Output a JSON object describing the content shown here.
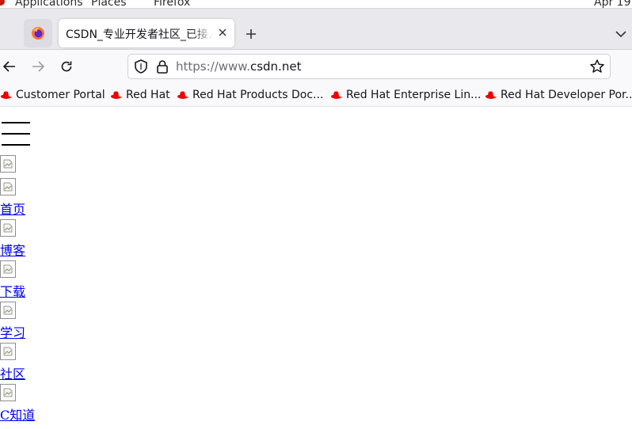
{
  "system_bar": {
    "applications": "Applications",
    "places": "Places",
    "app_name": "Firefox",
    "clock": "Apr 19"
  },
  "tabs": {
    "active_title": "CSDN_专业开发者社区_已接入",
    "close_icon": "close-icon",
    "new_tab_icon": "plus-icon",
    "list_icon": "chevron-down-icon"
  },
  "navbar": {
    "url_prefix": "https://www.",
    "url_host": "csdn.net",
    "icons": [
      "back-arrow-icon",
      "forward-arrow-icon",
      "reload-icon",
      "shield-icon",
      "lock-icon",
      "star-icon"
    ]
  },
  "bookmarks": [
    {
      "label": "Customer Portal"
    },
    {
      "label": "Red Hat"
    },
    {
      "label": "Red Hat Products Doc..."
    },
    {
      "label": "Red Hat Enterprise Lin..."
    },
    {
      "label": "Red Hat Developer Por..."
    }
  ],
  "page": {
    "nav_links": [
      "首页",
      "博客",
      "下载",
      "学习",
      "社区",
      "C知道"
    ]
  },
  "colors": {
    "link": "#0000ee",
    "redhat": "#ee0000",
    "tabbar": "#e8e8ed"
  }
}
